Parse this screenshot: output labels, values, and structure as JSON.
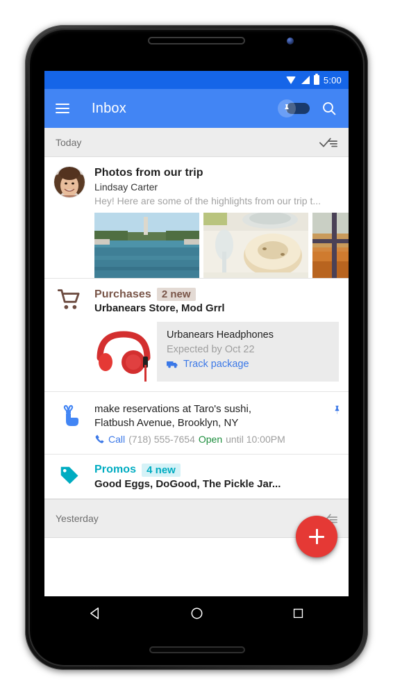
{
  "device": {
    "type": "android-phone",
    "nav": {
      "back_label": "Back",
      "home_label": "Home",
      "recents_label": "Recent apps"
    }
  },
  "status_bar": {
    "time": "5:00",
    "icons": [
      "wifi-icon",
      "signal-icon",
      "battery-icon"
    ],
    "background": "#1565E8"
  },
  "toolbar": {
    "menu_icon": "hamburger-menu-icon",
    "title": "Inbox",
    "pin_toggle": {
      "icon": "pin-icon",
      "state": "off"
    },
    "search_icon": "search-icon",
    "background": "#4285F4"
  },
  "sections": [
    {
      "label": "Today",
      "sweep_icon": "done-all-icon"
    },
    {
      "label": "Yesterday",
      "sweep_icon": "done-all-icon"
    }
  ],
  "items": {
    "email": {
      "avatar": "contact-avatar",
      "subject": "Photos from our trip",
      "sender": "Lindsay Carter",
      "snippet": "Hey! Here are some of the highlights from our trip t...",
      "thumbnails": [
        "photo-reflecting-pool",
        "photo-dessert-plate",
        "photo-autumn-window"
      ]
    },
    "purchases": {
      "icon": "shopping-cart-icon",
      "title": "Purchases",
      "badge": "2 new",
      "subtitle": "Urbanears Store, Mod Grrl",
      "color": "#795548",
      "badge_bg": "#E3DAD4",
      "card": {
        "image": "red-headphones-photo",
        "product": "Urbanears Headphones",
        "expected": "Expected by Oct 22",
        "link_icon": "delivery-truck-icon",
        "link_label": "Track package",
        "link_color": "#3B78E7",
        "background": "#EBEBEB"
      }
    },
    "reminder": {
      "icon": "finger-string-reminder-icon",
      "line1": "make reservations at Taro's sushi,",
      "line2": "Flatbush Avenue, Brooklyn, NY",
      "phone_icon": "phone-icon",
      "call_label": "Call",
      "phone_number": "(718) 555-7654",
      "open_label": "Open",
      "hours": "until 10:00PM",
      "pin_icon": "pin-icon"
    },
    "promos": {
      "icon": "price-tag-icon",
      "title": "Promos",
      "badge": "4 new",
      "subtitle": "Good Eggs, DoGood, The Pickle Jar...",
      "color": "#00ACC1",
      "badge_bg": "#D5F2F7"
    }
  },
  "fab": {
    "icon": "plus-icon",
    "color": "#E53935",
    "label": "Compose"
  }
}
